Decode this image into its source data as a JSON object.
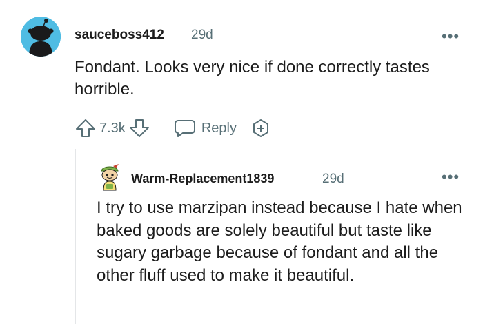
{
  "comment": {
    "author": "sauceboss412",
    "age": "29d",
    "more": "•••",
    "body": "Fondant. Looks very nice if done correctly tastes horrible.",
    "votes": "7.3k",
    "reply_label": "Reply",
    "avatar_color": "#4fbce3"
  },
  "reply": {
    "author": "Warm-Replacement1839",
    "age": "29d",
    "more": "•••",
    "body": "I try to use marzipan instead because I hate when baked goods are solely beautiful but taste like sugary garbage because of fondant and all the other fluff used to make it beautiful."
  },
  "icons": {
    "upvote": "upvote-icon",
    "downvote": "downvote-icon",
    "reply": "reply-bubble-icon",
    "award": "award-icon",
    "more": "more-icon"
  }
}
